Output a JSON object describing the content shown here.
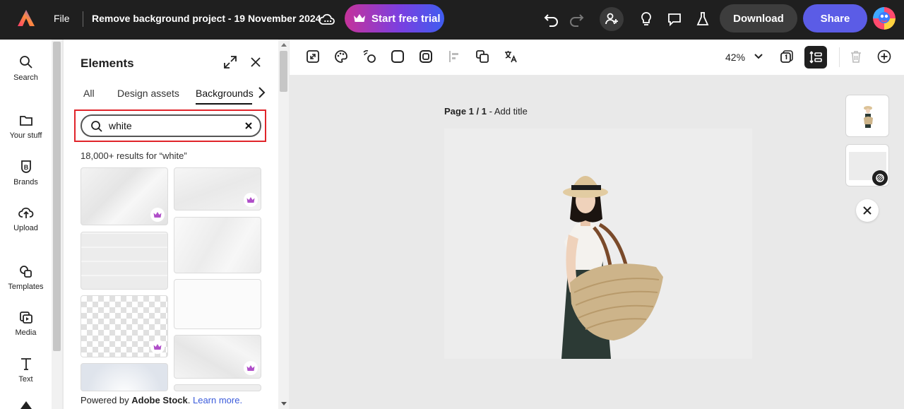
{
  "topbar": {
    "file_label": "File",
    "project_title": "Remove background project - 19 November 2024 ...",
    "trial_label": "Start free trial",
    "download_label": "Download",
    "share_label": "Share"
  },
  "rail": {
    "items": [
      {
        "label": "Search",
        "icon": "search-icon"
      },
      {
        "label": "Your stuff",
        "icon": "folder-icon"
      },
      {
        "label": "Brands",
        "icon": "brand-icon"
      },
      {
        "label": "Upload",
        "icon": "upload-icon"
      },
      {
        "label": "Templates",
        "icon": "templates-icon"
      },
      {
        "label": "Media",
        "icon": "media-icon"
      },
      {
        "label": "Text",
        "icon": "text-icon"
      }
    ]
  },
  "panel": {
    "title": "Elements",
    "tabs": [
      {
        "label": "All",
        "active": false
      },
      {
        "label": "Design assets",
        "active": false
      },
      {
        "label": "Backgrounds",
        "active": true
      }
    ],
    "search": {
      "value": "white",
      "placeholder": ""
    },
    "results_text": "18,000+ results for “white”",
    "powered_prefix": "Powered by ",
    "powered_brand": "Adobe Stock",
    "powered_suffix": ".",
    "learn_more": "Learn more."
  },
  "canvas": {
    "zoom": "42%",
    "page_label_bold": "Page 1 / 1",
    "page_label_sep": " - ",
    "page_label_title": "Add title"
  },
  "colors": {
    "topbar_bg": "#1f1f1f",
    "share_bg": "#5b5ce6",
    "highlight": "#e0242a"
  }
}
